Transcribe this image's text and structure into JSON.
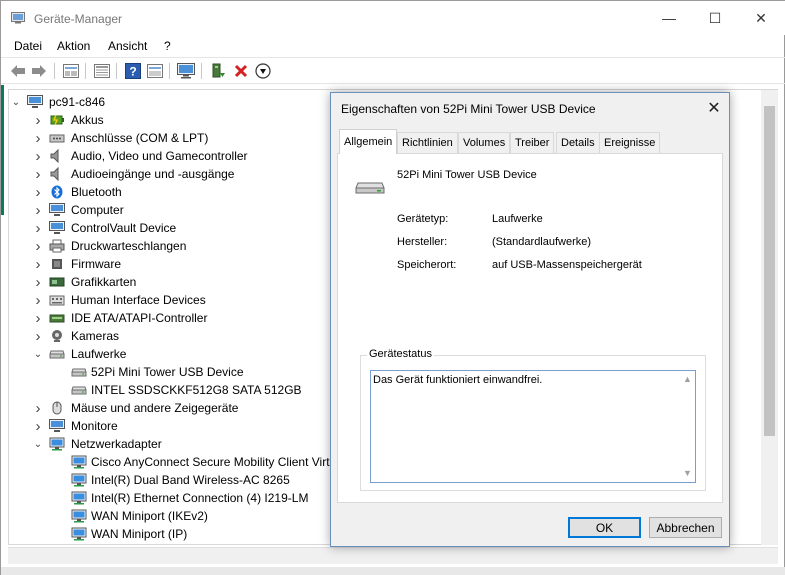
{
  "window": {
    "title": "Geräte-Manager",
    "controls": {
      "minimize": "—",
      "maximize": "☐",
      "close": "✕"
    }
  },
  "menu": [
    "Datei",
    "Aktion",
    "Ansicht",
    "?"
  ],
  "toolbar": {
    "icons": [
      "back-icon",
      "forward-icon",
      "properties-list-icon",
      "device-view-icon",
      "help-icon",
      "view-icon",
      "monitor-icon",
      "update-driver-icon",
      "uninstall-icon",
      "download-icon"
    ]
  },
  "tree": {
    "root": "pc91-c846",
    "items": [
      {
        "label": "Akkus",
        "icon": "battery-icon",
        "level": 1,
        "state": "collapsed"
      },
      {
        "label": "Anschlüsse (COM & LPT)",
        "icon": "port-icon",
        "level": 1,
        "state": "collapsed"
      },
      {
        "label": "Audio, Video und Gamecontroller",
        "icon": "speaker-icon",
        "level": 1,
        "state": "collapsed"
      },
      {
        "label": "Audioeingänge und -ausgänge",
        "icon": "speaker-icon",
        "level": 1,
        "state": "collapsed"
      },
      {
        "label": "Bluetooth",
        "icon": "bluetooth-icon",
        "level": 1,
        "state": "collapsed"
      },
      {
        "label": "Computer",
        "icon": "computer-icon",
        "level": 1,
        "state": "collapsed"
      },
      {
        "label": "ControlVault Device",
        "icon": "monitor-icon",
        "level": 1,
        "state": "collapsed"
      },
      {
        "label": "Druckwarteschlangen",
        "icon": "printer-icon",
        "level": 1,
        "state": "collapsed"
      },
      {
        "label": "Firmware",
        "icon": "firmware-icon",
        "level": 1,
        "state": "collapsed"
      },
      {
        "label": "Grafikkarten",
        "icon": "display-adapter-icon",
        "level": 1,
        "state": "collapsed"
      },
      {
        "label": "Human Interface Devices",
        "icon": "hid-icon",
        "level": 1,
        "state": "collapsed"
      },
      {
        "label": "IDE ATA/ATAPI-Controller",
        "icon": "ide-controller-icon",
        "level": 1,
        "state": "collapsed"
      },
      {
        "label": "Kameras",
        "icon": "camera-icon",
        "level": 1,
        "state": "collapsed"
      },
      {
        "label": "Laufwerke",
        "icon": "drive-icon",
        "level": 1,
        "state": "expanded"
      },
      {
        "label": "52Pi Mini Tower USB Device",
        "icon": "drive-icon",
        "level": 2,
        "state": "leaf"
      },
      {
        "label": "INTEL SSDSCKKF512G8 SATA 512GB",
        "icon": "drive-icon",
        "level": 2,
        "state": "leaf"
      },
      {
        "label": "Mäuse und andere Zeigegeräte",
        "icon": "mouse-icon",
        "level": 1,
        "state": "collapsed"
      },
      {
        "label": "Monitore",
        "icon": "monitor-icon",
        "level": 1,
        "state": "collapsed"
      },
      {
        "label": "Netzwerkadapter",
        "icon": "network-adapter-icon",
        "level": 1,
        "state": "expanded"
      },
      {
        "label": "Cisco AnyConnect Secure Mobility Client Virtu",
        "icon": "network-adapter-icon",
        "level": 2,
        "state": "leaf"
      },
      {
        "label": "Intel(R) Dual Band Wireless-AC 8265",
        "icon": "network-adapter-icon",
        "level": 2,
        "state": "leaf"
      },
      {
        "label": "Intel(R) Ethernet Connection (4) I219-LM",
        "icon": "network-adapter-icon",
        "level": 2,
        "state": "leaf"
      },
      {
        "label": "WAN Miniport (IKEv2)",
        "icon": "network-adapter-icon",
        "level": 2,
        "state": "leaf"
      },
      {
        "label": "WAN Miniport (IP)",
        "icon": "network-adapter-icon",
        "level": 2,
        "state": "leaf"
      }
    ]
  },
  "dialog": {
    "title": "Eigenschaften von 52Pi Mini Tower USB Device",
    "tabs": [
      "Allgemein",
      "Richtlinien",
      "Volumes",
      "Treiber",
      "Details",
      "Ereignisse"
    ],
    "active_tab": "Allgemein",
    "device_name": "52Pi Mini Tower USB Device",
    "properties": {
      "type_label": "Gerätetyp:",
      "type_value": "Laufwerke",
      "manufacturer_label": "Hersteller:",
      "manufacturer_value": "(Standardlaufwerke)",
      "location_label": "Speicherort:",
      "location_value": "auf USB-Massenspeichergerät"
    },
    "status_group_label": "Gerätestatus",
    "status_text": "Das Gerät funktioniert einwandfrei.",
    "ok_label": "OK",
    "cancel_label": "Abbrechen"
  }
}
